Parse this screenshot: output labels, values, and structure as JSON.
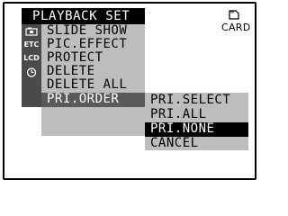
{
  "header": {
    "title": "PLAYBACK SET"
  },
  "side_icons": [
    {
      "name": "camera-icon",
      "label": ""
    },
    {
      "name": "etc-icon",
      "label": "ETC"
    },
    {
      "name": "lcd-icon",
      "label": "LCD"
    },
    {
      "name": "clock-icon",
      "label": ""
    }
  ],
  "menu": {
    "items": [
      {
        "label": "SLIDE SHOW"
      },
      {
        "label": "PIC.EFFECT"
      },
      {
        "label": "PROTECT"
      },
      {
        "label": "DELETE"
      },
      {
        "label": "DELETE ALL"
      },
      {
        "label": "PRI.ORDER"
      }
    ],
    "selected_index": 5
  },
  "submenu": {
    "items": [
      {
        "label": "PRI.SELECT"
      },
      {
        "label": "PRI.ALL"
      },
      {
        "label": "PRI.NONE"
      },
      {
        "label": "CANCEL"
      }
    ],
    "selected_index": 2
  },
  "media": {
    "icon": "memory-card-icon",
    "label": "CARD"
  },
  "colors": {
    "header_bg": "#000000",
    "menu_bg": "#bdbdbd",
    "side_strip_bg": "#4a4a4a",
    "selected_bg": "#5a5a5a",
    "highlight_bg": "#000000",
    "highlight_text": "#ffffff"
  }
}
